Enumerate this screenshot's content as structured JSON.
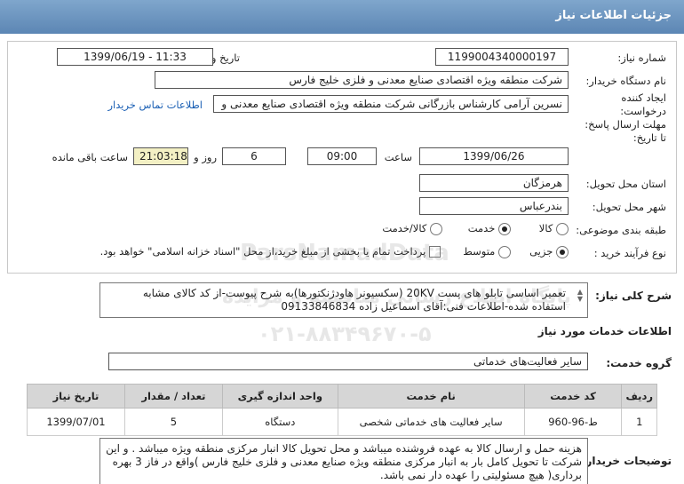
{
  "header": {
    "title": "جزئیات اطلاعات نیاز"
  },
  "fields": {
    "need_number_label": "شماره نیاز:",
    "need_number": "1199004340000197",
    "announce_label": "تاریخ و ساعت اعلان عمومی:",
    "announce_value": "1399/06/19 - 11:33",
    "buyer_label": "نام دستگاه خریدار:",
    "buyer_value": "شرکت منطقه ویژه اقتصادی صنایع معدنی و فلزی خلیج فارس",
    "creator_label_1": "ایجاد کننده",
    "creator_label_2": "درخواست:",
    "creator_value": "نسرین  آرامی  کارشناس بازرگانی  شرکت منطقه ویژه اقتصادی صنایع معدنی و",
    "contact_link": "اطلاعات تماس خریدار",
    "deadline_label_1": "مهلت ارسال پاسخ:",
    "deadline_label_2": "تا تاریخ:",
    "deadline_date": "1399/06/26",
    "time_label": "ساعت",
    "deadline_time": "09:00",
    "days_value": "6",
    "days_label": "روز و",
    "remaining_time": "21:03:18",
    "remaining_label": "ساعت باقی مانده",
    "province_label": "استان محل تحویل:",
    "province_value": "هرمزگان",
    "city_label": "شهر محل تحویل:",
    "city_value": "بندرعباس",
    "category_label": "طبقه بندی موضوعی:",
    "category_options": [
      "کالا",
      "خدمت",
      "کالا/خدمت"
    ],
    "purchase_label": "نوع فرآیند خرید :",
    "purchase_options": [
      "جزیی",
      "متوسط"
    ],
    "payment_note": "پرداخت تمام یا بخشی از مبلغ خرید،از محل \"اسناد خزانه اسلامی\" خواهد بود."
  },
  "summary": {
    "label": "شرح کلی نیاز:",
    "text": "تعمیر اساسی تابلو های پست 20KV (سکسیونر هاودژنکتورها)به شرح پیوست-از کد کالای مشابه استفاده شده-اطلاعات فنی:آقای اسماعیل زاده 09133846834"
  },
  "services": {
    "section_title": "اطلاعات خدمات مورد نیاز",
    "group_label": "گروه خدمت:",
    "group_value": "سایر فعالیت‌های خدماتی",
    "columns": [
      "ردیف",
      "کد خدمت",
      "نام خدمت",
      "واحد اندازه گیری",
      "تعداد / مقدار",
      "تاریخ نیاز"
    ],
    "rows": [
      [
        "1",
        "ط-96-960",
        "سایر فعالیت های خدماتی شخصی",
        "دستگاه",
        "5",
        "1399/07/01"
      ]
    ]
  },
  "buyer_notes": {
    "label": "توضیحات خریدار:",
    "text": "هزینه حمل و ارسال کالا به عهده فروشنده میباشد و محل تحویل کالا انبار مرکزی منطقه ویژه میباشد . و این شرکت تا تحویل کامل بار به انبار مرکزی منطقه ویژه صنایع معدنی و فلزی خلیج فارس )واقع در فاز 3 بهره برداری( هیچ مسئولیتی را عهده دار نمی باشد."
  },
  "watermark": {
    "line1": "ParsNamadData",
    "line2": "پایگاه اطلاع رسانی مناقصه و مزایده",
    "line3": "۰۲۱-۸۸۳۴۹۶۷۰-۵"
  }
}
